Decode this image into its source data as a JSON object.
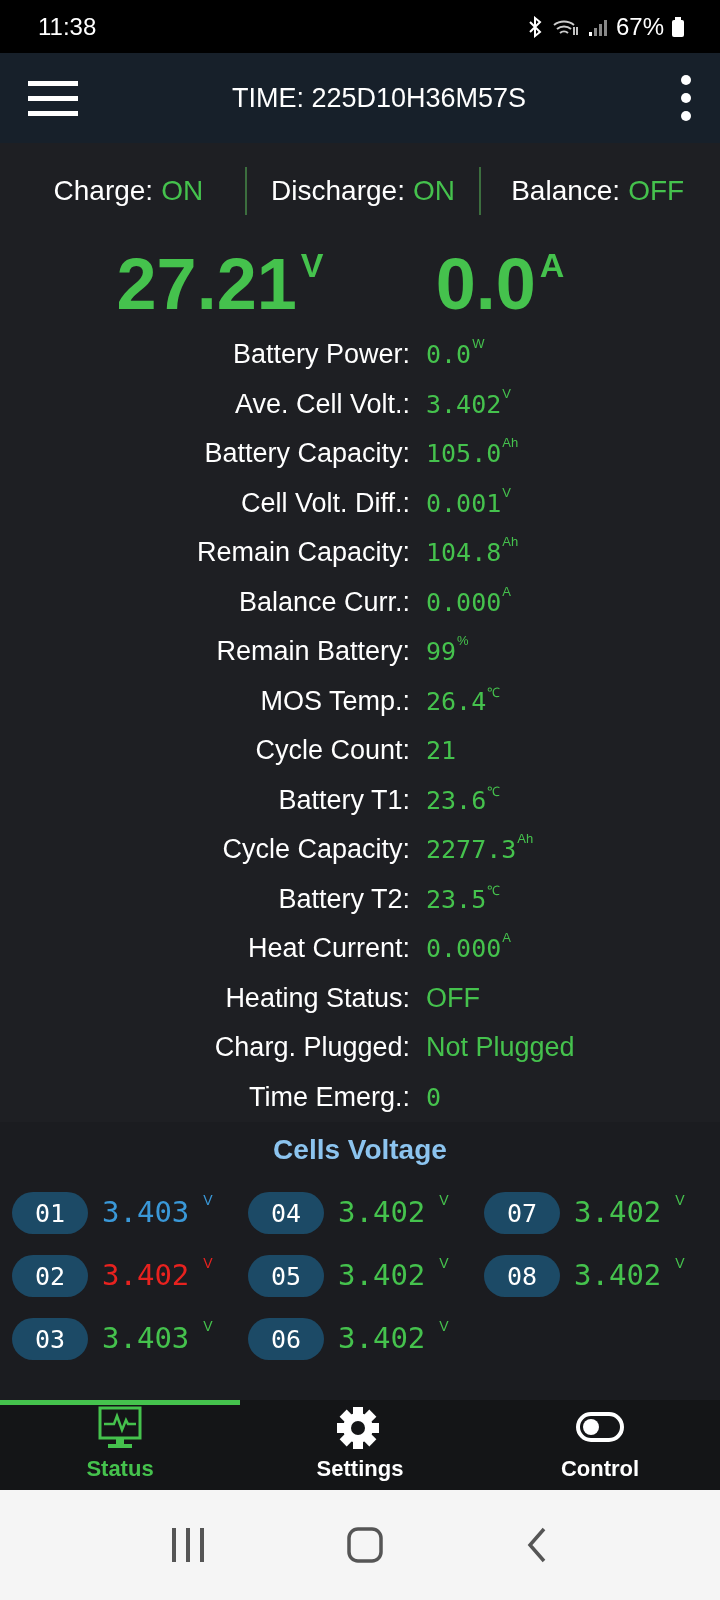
{
  "status_bar": {
    "time": "11:38",
    "battery": "67%"
  },
  "app_bar": {
    "title": "TIME: 225D10H36M57S"
  },
  "switches": [
    {
      "label": "Charge:",
      "value": "ON"
    },
    {
      "label": "Discharge:",
      "value": "ON"
    },
    {
      "label": "Balance:",
      "value": "OFF"
    }
  ],
  "readings": [
    {
      "value": "27.21",
      "unit": "V"
    },
    {
      "value": "0.0",
      "unit": "A"
    }
  ],
  "stats": [
    {
      "label": "Battery Power:",
      "value": "0.0",
      "unit": "W",
      "kind": "number"
    },
    {
      "label": "Ave. Cell Volt.:",
      "value": "3.402",
      "unit": "V",
      "kind": "number"
    },
    {
      "label": "Battery Capacity:",
      "value": "105.0",
      "unit": "Ah",
      "kind": "number"
    },
    {
      "label": "Cell Volt. Diff.:",
      "value": "0.001",
      "unit": "V",
      "kind": "number"
    },
    {
      "label": "Remain Capacity:",
      "value": "104.8",
      "unit": "Ah",
      "kind": "number"
    },
    {
      "label": "Balance Curr.:",
      "value": "0.000",
      "unit": "A",
      "kind": "number"
    },
    {
      "label": "Remain Battery:",
      "value": "99",
      "unit": "%",
      "kind": "number"
    },
    {
      "label": "MOS Temp.:",
      "value": "26.4",
      "unit": "℃",
      "kind": "number"
    },
    {
      "label": "Cycle Count:",
      "value": "21",
      "kind": "number"
    },
    {
      "label": "Battery T1:",
      "value": "23.6",
      "unit": "℃",
      "kind": "number"
    },
    {
      "label": "Cycle Capacity:",
      "value": "2277.3",
      "unit": "Ah",
      "kind": "number"
    },
    {
      "label": "Battery T2:",
      "value": "23.5",
      "unit": "℃",
      "kind": "number"
    },
    {
      "label": "Heat Current:",
      "value": "0.000",
      "unit": "A",
      "kind": "number"
    },
    {
      "label": "Heating Status:",
      "value": "OFF",
      "kind": "text"
    },
    {
      "label": "Charg. Plugged:",
      "value": "Not Plugged",
      "kind": "text"
    },
    {
      "label": "Time Emerg.:",
      "value": "0",
      "kind": "number"
    }
  ],
  "cells": {
    "title": "Cells Voltage",
    "items": [
      {
        "index": "01",
        "value": "3.403",
        "unit": "V",
        "color": "#3a98d8"
      },
      {
        "index": "02",
        "value": "3.402",
        "unit": "V",
        "color": "#e8221f"
      },
      {
        "index": "03",
        "value": "3.403",
        "unit": "V",
        "color": "#45c24d"
      },
      {
        "index": "04",
        "value": "3.402",
        "unit": "V",
        "color": "#45c24d"
      },
      {
        "index": "05",
        "value": "3.402",
        "unit": "V",
        "color": "#45c24d"
      },
      {
        "index": "06",
        "value": "3.402",
        "unit": "V",
        "color": "#45c24d"
      },
      {
        "index": "07",
        "value": "3.402",
        "unit": "V",
        "color": "#45c24d"
      },
      {
        "index": "08",
        "value": "3.402",
        "unit": "V",
        "color": "#45c24d"
      }
    ]
  },
  "tabs": [
    {
      "label": "Status",
      "kind": "status",
      "selected": true
    },
    {
      "label": "Settings",
      "kind": "settings",
      "selected": false
    },
    {
      "label": "Control",
      "kind": "control",
      "selected": false
    }
  ]
}
